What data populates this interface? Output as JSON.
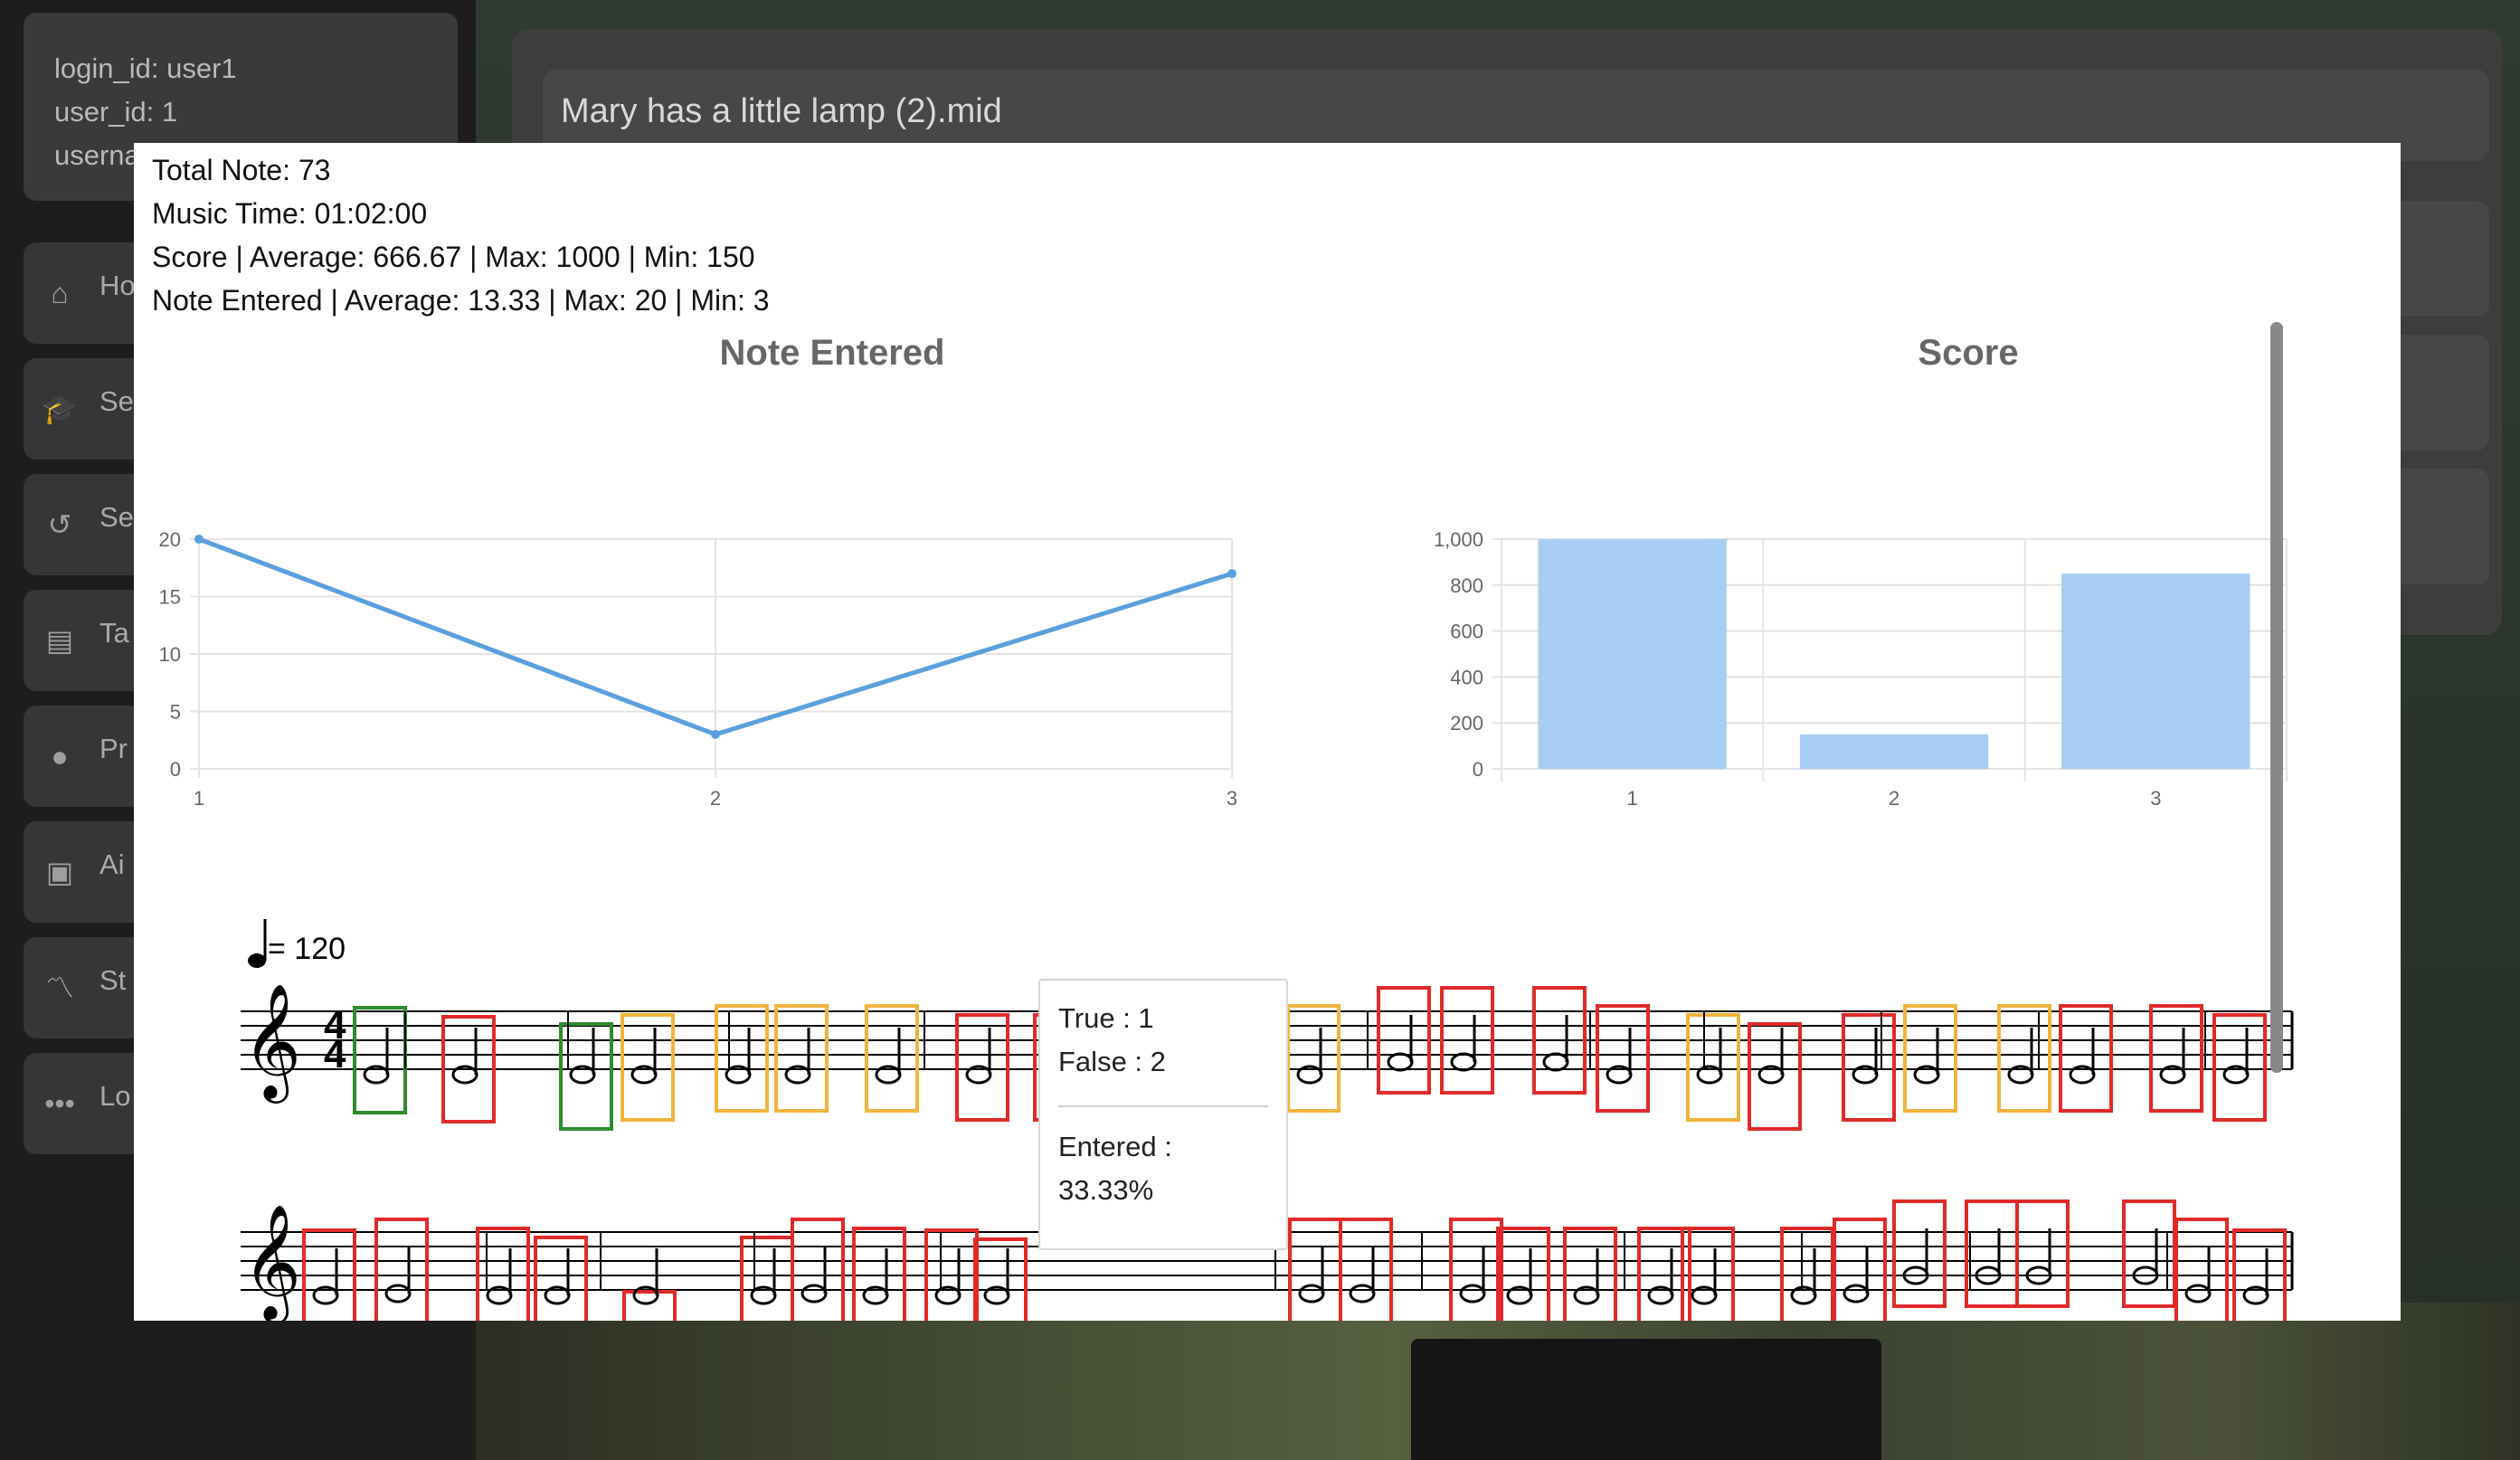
{
  "user": {
    "login_id": "login_id: user1",
    "user_id": "user_id: 1",
    "username": "userna"
  },
  "sidebar": {
    "items": [
      {
        "label": "Ho",
        "icon": "home-icon"
      },
      {
        "label": "Se",
        "icon": "graduation-cap-icon"
      },
      {
        "label": "Se",
        "icon": "history-icon"
      },
      {
        "label": "Ta",
        "icon": "table-icon"
      },
      {
        "label": "Pr",
        "icon": "user-icon"
      },
      {
        "label": "Ai",
        "icon": "robot-icon"
      },
      {
        "label": "St",
        "icon": "line-chart-icon"
      },
      {
        "label": "Lo",
        "icon": "more-dots-icon"
      }
    ]
  },
  "file_name": "Mary has a little lamp (2).mid",
  "stats": {
    "total_note": "Total Note: 73",
    "music_time": "Music Time: 01:02:00",
    "score_summary": "Score | Average: 666.67 | Max: 1000 | Min: 150",
    "note_entered_summary": "Note Entered | Average: 13.33 | Max: 20 | Min: 3"
  },
  "chart_data": [
    {
      "type": "line",
      "title": "Note Entered",
      "x": [
        1,
        2,
        3
      ],
      "values": [
        20,
        3,
        17
      ],
      "ylim": [
        0,
        20
      ],
      "yticks": [
        0,
        5,
        10,
        15,
        20
      ],
      "grid": true,
      "color": "#5b9fde"
    },
    {
      "type": "bar",
      "title": "Score",
      "categories": [
        "1",
        "2",
        "3"
      ],
      "values": [
        1000,
        150,
        850
      ],
      "ylim": [
        0,
        1000
      ],
      "yticks": [
        "0",
        "200",
        "400",
        "600",
        "800",
        "1,000"
      ],
      "grid": true,
      "color": "#a8cdf2"
    }
  ],
  "sheet": {
    "tempo": "= 120",
    "time_signature_top": "4",
    "time_signature_bottom": "4",
    "colors": {
      "correct": "#2e8b2e",
      "partial": "#f0b43c",
      "wrong": "#e02a2a",
      "selected_fill": "#f08080"
    }
  },
  "tooltip": {
    "true_line": "True : 1",
    "false_line": "False : 2",
    "entered_label": "Entered :",
    "entered_value": "33.33%"
  }
}
